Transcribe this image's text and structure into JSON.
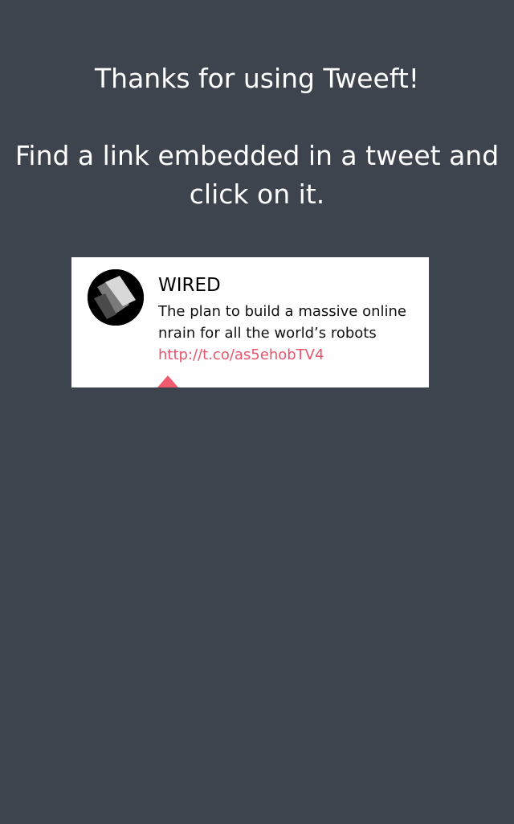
{
  "intro": {
    "thanks_text": "Thanks for using Tweeft!",
    "instruction_text": "Find a link embedded in a tweet and click on it."
  },
  "tweet": {
    "author": "WIRED",
    "text": "The plan to build a massive online nrain for all the world’s robots",
    "link": "http://t.co/as5ehobTV4",
    "avatar_icon": "wired-logo-icon"
  },
  "colors": {
    "background": "#3e444e",
    "card": "#ffffff",
    "link": "#e8546b",
    "pointer": "#f05a6e"
  }
}
